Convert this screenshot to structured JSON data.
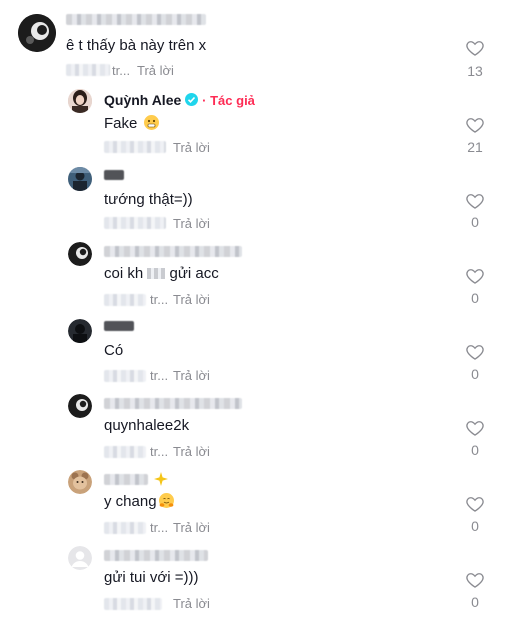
{
  "comments": [
    {
      "text": "ê t thấy bà này trên x",
      "meta": "tr...",
      "reply": "Trả lời",
      "likes": "13"
    },
    {
      "name": "Quỳnh Alee",
      "author_tag": "· Tác giả",
      "text": "Fake",
      "reply": "Trả lời",
      "likes": "21"
    },
    {
      "text": "tướng thật=))",
      "reply": "Trả lời",
      "likes": "0"
    },
    {
      "text_a": "coi kh",
      "text_b": "gửi acc",
      "meta": "tr...",
      "reply": "Trả lời",
      "likes": "0"
    },
    {
      "text": "Có",
      "meta": "tr...",
      "reply": "Trả lời",
      "likes": "0"
    },
    {
      "text": "quynhalee2k",
      "meta": "tr...",
      "reply": "Trả lời",
      "likes": "0"
    },
    {
      "text": "y chang",
      "meta": "tr...",
      "reply": "Trả lời",
      "likes": "0"
    },
    {
      "text": "gửi tui với =)))",
      "reply": "Trả lời",
      "likes": "0"
    }
  ],
  "icons": {
    "like": "heart-outline-icon",
    "verified": "verified-badge-icon",
    "emoji_fake": "grimacing-face-emoji",
    "emoji_hug": "hugging-face-emoji",
    "emoji_sparkle": "sparkle-emoji"
  },
  "colors": {
    "author_tag": "#fe2c55",
    "verified": "#20d5ec",
    "secondary_text": "#8a8b91"
  }
}
